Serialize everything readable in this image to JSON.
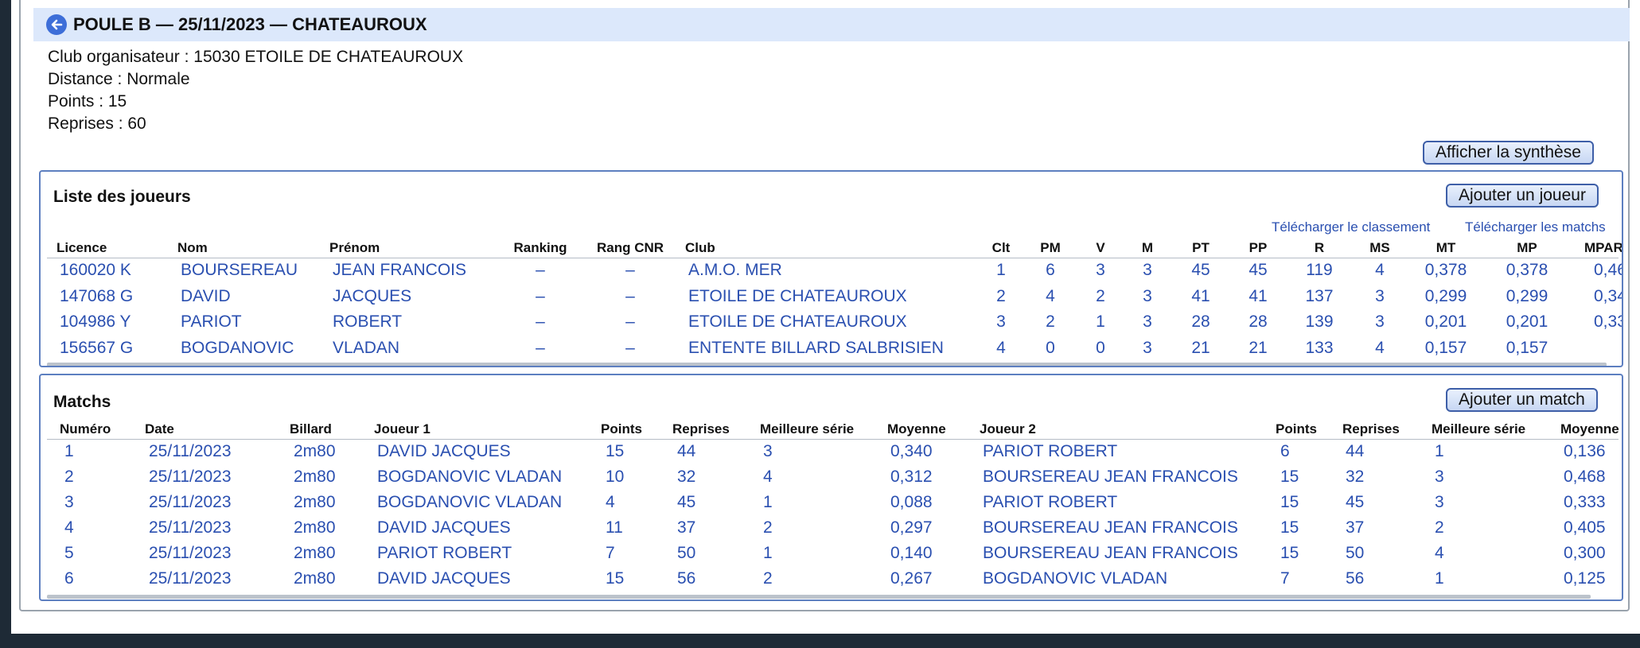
{
  "header": {
    "title": "POULE B — 25/11/2023 — CHATEAUROUX"
  },
  "info": {
    "club": "Club organisateur : 15030 ETOILE DE CHATEAUROUX",
    "distance": "Distance : Normale",
    "points": "Points : 15",
    "reprises": "Reprises : 60"
  },
  "buttons": {
    "synthese": "Afficher la synthèse",
    "add_player": "Ajouter un joueur",
    "add_match": "Ajouter un match"
  },
  "players": {
    "title": "Liste des joueurs",
    "download_ranking": "Télécharger le classement",
    "download_matches": "Télécharger les matchs",
    "columns": [
      "Licence",
      "Nom",
      "Prénom",
      "Ranking",
      "Rang CNR",
      "Club",
      "Clt",
      "PM",
      "V",
      "M",
      "PT",
      "PP",
      "R",
      "MS",
      "MT",
      "MP",
      "MPAR"
    ],
    "rows": [
      [
        "160020 K",
        "BOURSEREAU",
        "JEAN FRANCOIS",
        "–",
        "–",
        "A.M.O. MER",
        "1",
        "6",
        "3",
        "3",
        "45",
        "45",
        "119",
        "4",
        "0,378",
        "0,378",
        "0,46"
      ],
      [
        "147068 G",
        "DAVID",
        "JACQUES",
        "–",
        "–",
        "ETOILE DE CHATEAUROUX",
        "2",
        "4",
        "2",
        "3",
        "41",
        "41",
        "137",
        "3",
        "0,299",
        "0,299",
        "0,34"
      ],
      [
        "104986 Y",
        "PARIOT",
        "ROBERT",
        "–",
        "–",
        "ETOILE DE CHATEAUROUX",
        "3",
        "2",
        "1",
        "3",
        "28",
        "28",
        "139",
        "3",
        "0,201",
        "0,201",
        "0,33"
      ],
      [
        "156567 G",
        "BOGDANOVIC",
        "VLADAN",
        "–",
        "–",
        "ENTENTE BILLARD SALBRISIEN",
        "4",
        "0",
        "0",
        "3",
        "21",
        "21",
        "133",
        "4",
        "0,157",
        "0,157",
        ""
      ]
    ]
  },
  "matches": {
    "title": "Matchs",
    "columns": [
      "Numéro",
      "Date",
      "Billard",
      "Joueur 1",
      "Points",
      "Reprises",
      "Meilleure série",
      "Moyenne",
      "Joueur 2",
      "Points",
      "Reprises",
      "Meilleure série",
      "Moyenne"
    ],
    "rows": [
      [
        "1",
        "25/11/2023",
        "2m80",
        "DAVID JACQUES",
        "15",
        "44",
        "3",
        "0,340",
        "PARIOT ROBERT",
        "6",
        "44",
        "1",
        "0,136"
      ],
      [
        "2",
        "25/11/2023",
        "2m80",
        "BOGDANOVIC VLADAN",
        "10",
        "32",
        "4",
        "0,312",
        "BOURSEREAU JEAN FRANCOIS",
        "15",
        "32",
        "3",
        "0,468"
      ],
      [
        "3",
        "25/11/2023",
        "2m80",
        "BOGDANOVIC VLADAN",
        "4",
        "45",
        "1",
        "0,088",
        "PARIOT ROBERT",
        "15",
        "45",
        "3",
        "0,333"
      ],
      [
        "4",
        "25/11/2023",
        "2m80",
        "DAVID JACQUES",
        "11",
        "37",
        "2",
        "0,297",
        "BOURSEREAU JEAN FRANCOIS",
        "15",
        "37",
        "2",
        "0,405"
      ],
      [
        "5",
        "25/11/2023",
        "2m80",
        "PARIOT ROBERT",
        "7",
        "50",
        "1",
        "0,140",
        "BOURSEREAU JEAN FRANCOIS",
        "15",
        "50",
        "4",
        "0,300"
      ],
      [
        "6",
        "25/11/2023",
        "2m80",
        "DAVID JACQUES",
        "15",
        "56",
        "2",
        "0,267",
        "BOGDANOVIC VLADAN",
        "7",
        "56",
        "1",
        "0,125"
      ]
    ]
  },
  "colors": {
    "accent": "#2a4fb0",
    "header_bg": "#dce8fb",
    "border": "#5d7fc0"
  }
}
